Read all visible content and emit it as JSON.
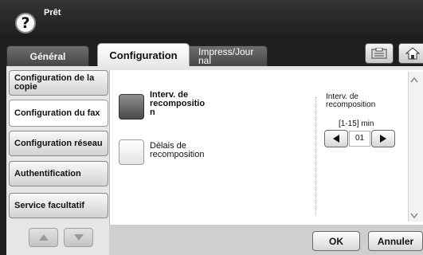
{
  "status": {
    "text": "Prêt"
  },
  "tabs": [
    {
      "label": "Général"
    },
    {
      "label": "Configuration"
    },
    {
      "label": "Impress/Jour nal"
    }
  ],
  "sidebar": {
    "items": [
      {
        "label": "Configuration de la copie"
      },
      {
        "label": "Configuration du fax"
      },
      {
        "label": "Configuration réseau"
      },
      {
        "label": "Authentification"
      },
      {
        "label": "Service facultatif"
      }
    ]
  },
  "options": [
    {
      "label": "Interv. de recompositio n",
      "selected": true
    },
    {
      "label": "Délais de recomposition",
      "selected": false
    }
  ],
  "interval": {
    "title": "Interv. de recomposition",
    "range": "[1-15] min",
    "value": "01"
  },
  "footer": {
    "ok_label": "OK",
    "cancel_label": "Annuler"
  }
}
